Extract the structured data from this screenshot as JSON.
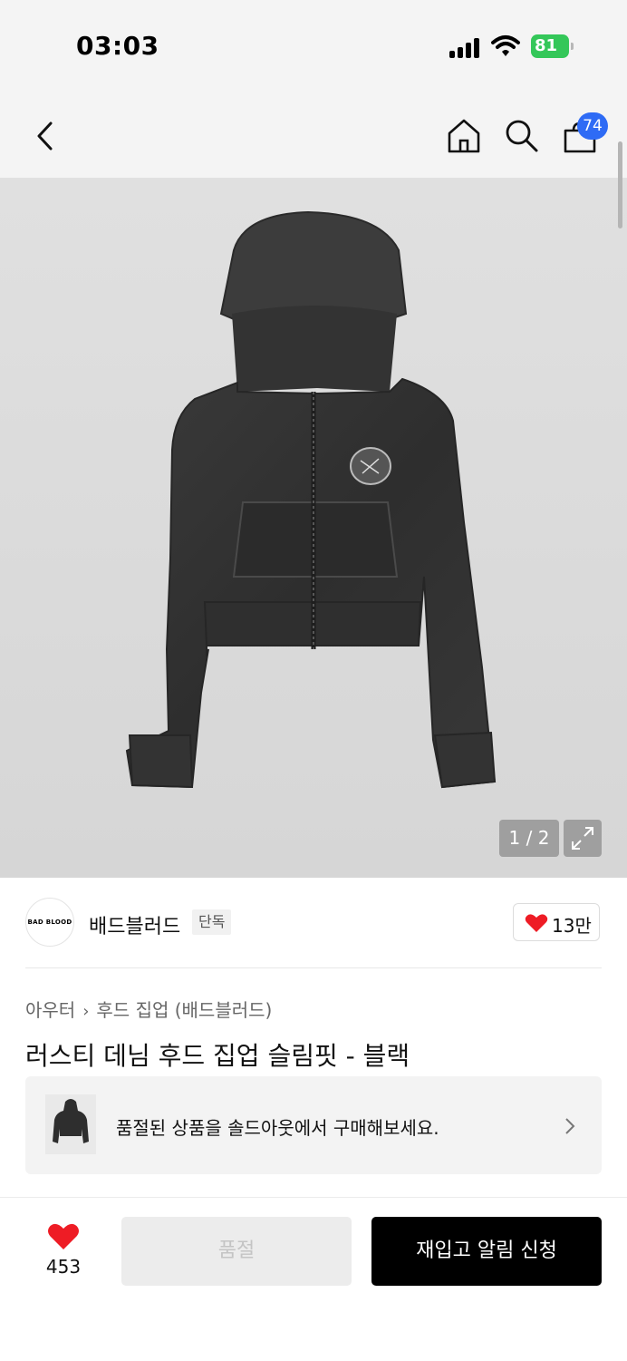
{
  "status_bar": {
    "time": "03:03",
    "battery": "81"
  },
  "nav": {
    "back_icon": "chevron-left-icon",
    "home_icon": "home-icon",
    "search_icon": "search-icon",
    "cart_icon": "shopping-bag-icon",
    "cart_count": "74",
    "badge_color": "#2e6bf5"
  },
  "gallery": {
    "counter": "1 / 2",
    "expand_icon": "expand-icon",
    "current_index": 1,
    "total": 2
  },
  "brand": {
    "logo_text": "BAD BLOOD",
    "name": "배드블러드",
    "tag": "단독",
    "like_icon": "heart-icon",
    "like_count": "13만"
  },
  "breadcrumb": {
    "items": [
      "아우터",
      "후드 집업 (배드블러드)"
    ],
    "separator_icon": "chevron-right-icon"
  },
  "product": {
    "title": "러스티 데님 후드 집업 슬림핏 - 블랙"
  },
  "soldout_banner": {
    "text": "품절된 상품을 솔드아웃에서 구매해보세요.",
    "chevron_icon": "chevron-right-icon"
  },
  "bottom_bar": {
    "wish_icon": "heart-icon",
    "wish_count": "453",
    "soldout_label": "품절",
    "restock_label": "재입고 알림 신청",
    "heart_color": "#ee1c25"
  }
}
